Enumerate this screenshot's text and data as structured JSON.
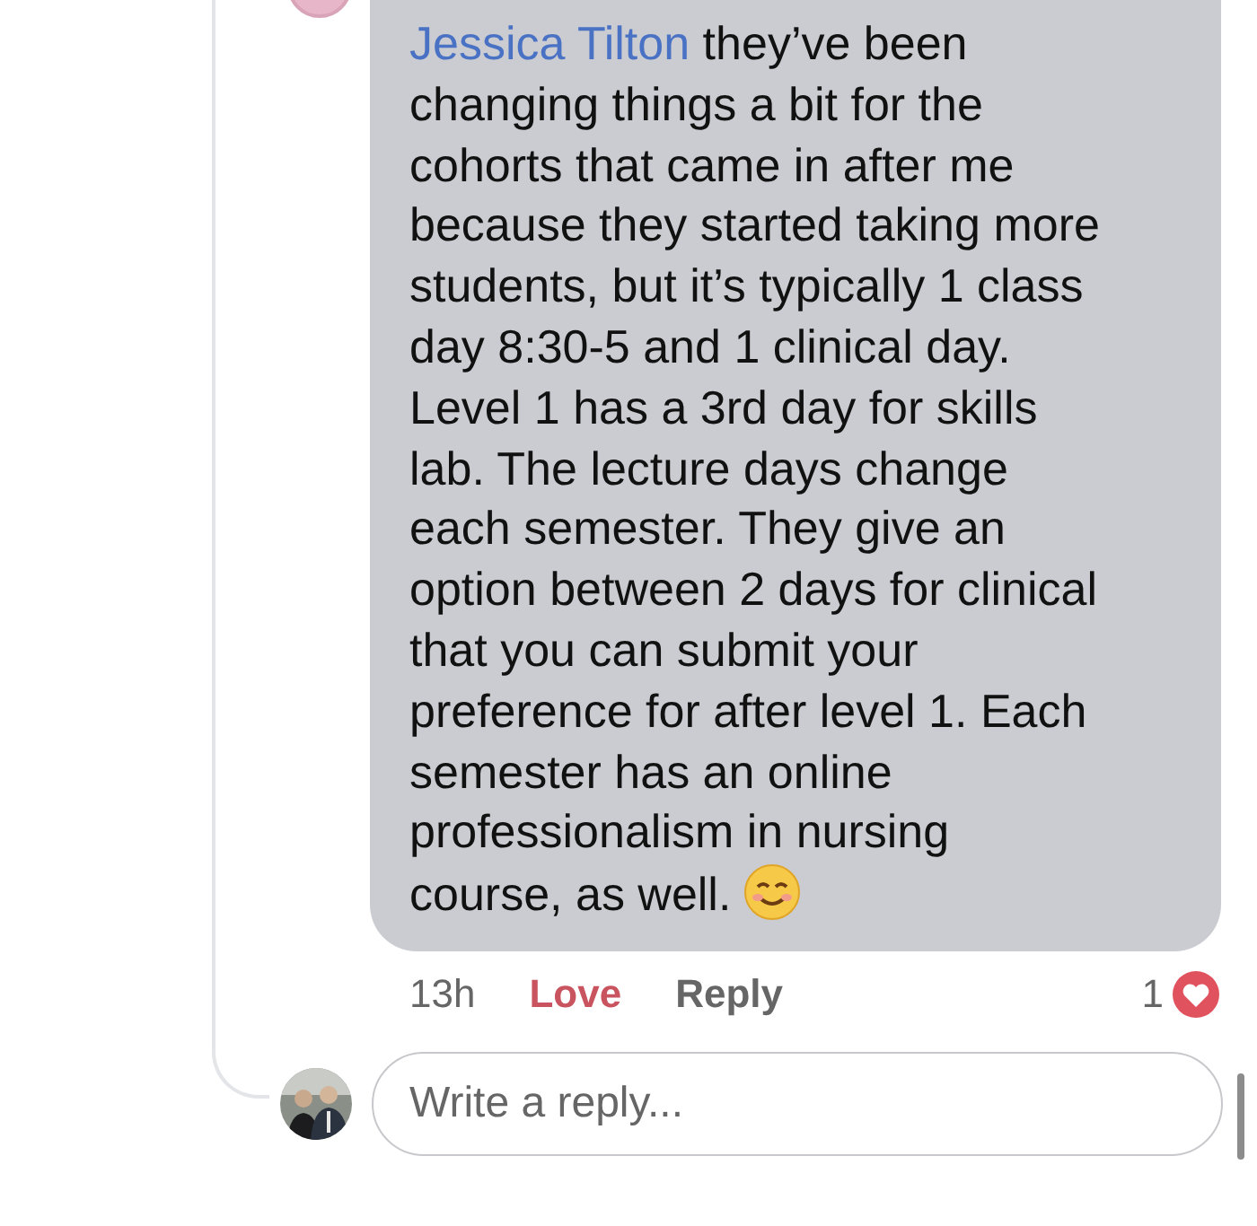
{
  "comment": {
    "mention": "Jessica Tilton",
    "lines": [
      " they’ve been",
      "changing things a bit for the",
      "cohorts that came in after me",
      "because they started taking more",
      "students, but it’s typically 1 class",
      "day 8:30-5 and 1 clinical day.",
      "Level 1 has a 3rd day for skills",
      "lab. The lecture days change",
      "each semester. They give an",
      "option between 2 days for clinical",
      "that you can submit your",
      "preference for after level 1. Each",
      "semester has an online",
      "professionalism in nursing",
      "course, as well."
    ],
    "time": "13h",
    "love": {
      "label": "Love",
      "selected": true
    },
    "reply": "Reply",
    "reaction_count": "1"
  },
  "reply_field": {
    "placeholder": "Write a reply..."
  }
}
